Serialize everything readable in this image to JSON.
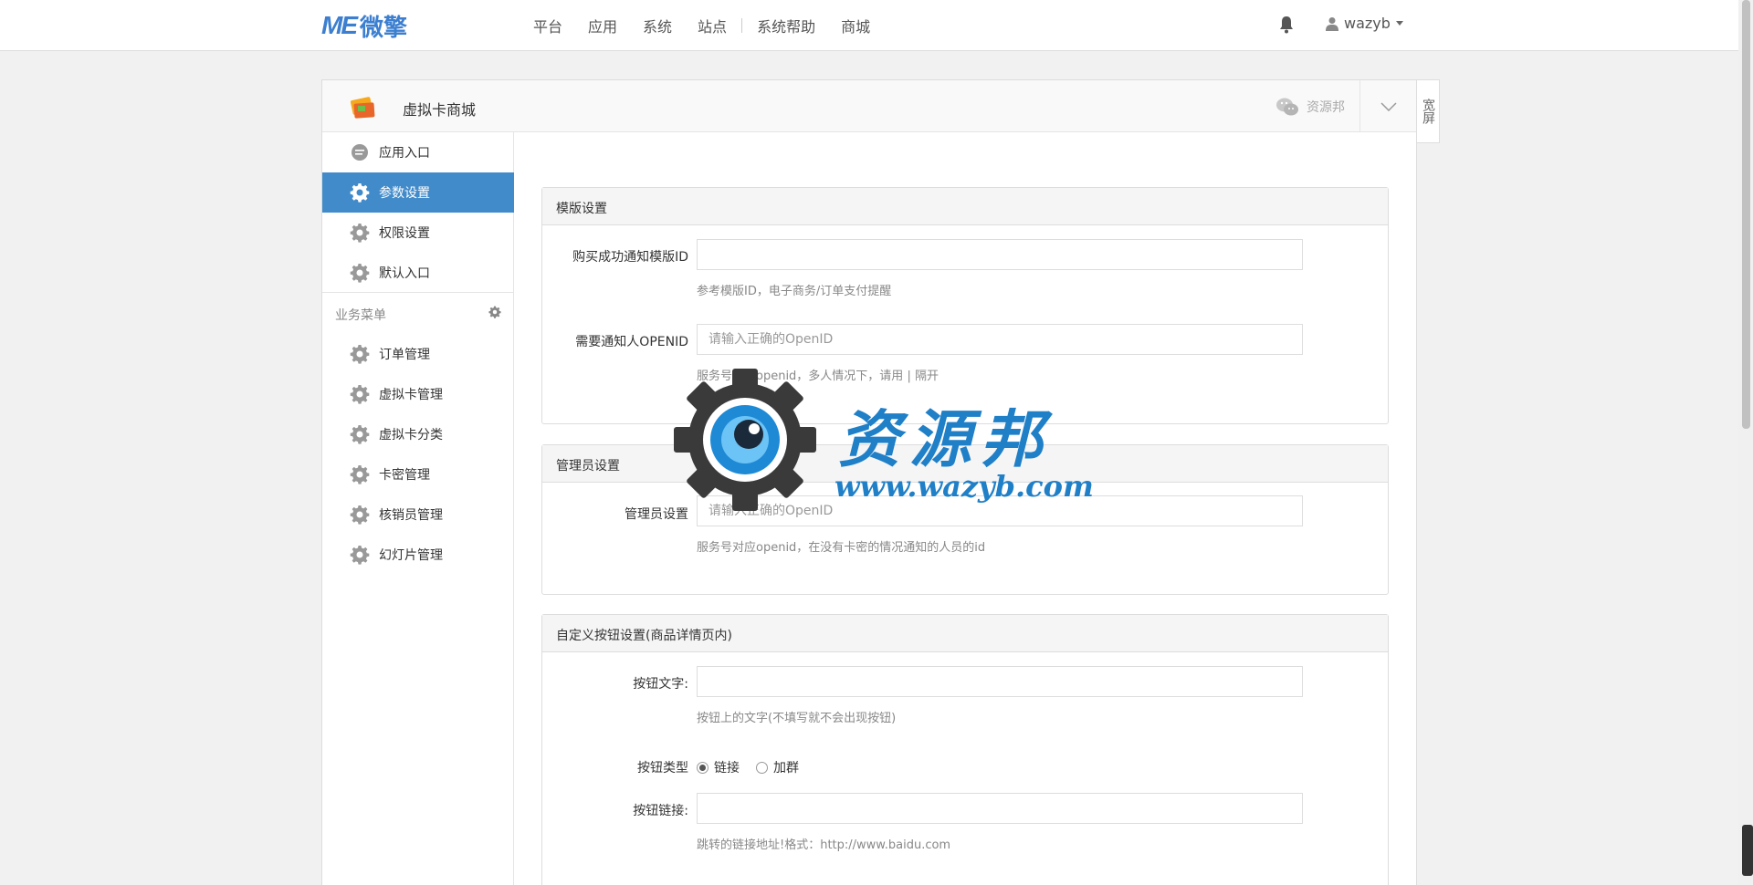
{
  "topbar": {
    "logo_me": "ME",
    "logo_cn": "微擎",
    "nav": [
      "平台",
      "应用",
      "系统",
      "站点",
      "系统帮助",
      "商城"
    ],
    "username": "wazyb"
  },
  "panel": {
    "app_title": "虚拟卡商城",
    "wechat_account": "资源邦",
    "wide_label": "宽屏"
  },
  "sidebar": {
    "items": [
      {
        "label": "应用入口",
        "icon": "chat-icon"
      },
      {
        "label": "参数设置",
        "icon": "gear-icon",
        "active": true
      },
      {
        "label": "权限设置",
        "icon": "gear-icon"
      },
      {
        "label": "默认入口",
        "icon": "gear-icon"
      }
    ],
    "group_title": "业务菜单",
    "business_items": [
      {
        "label": "订单管理",
        "icon": "gear-icon"
      },
      {
        "label": "虚拟卡管理",
        "icon": "gear-icon"
      },
      {
        "label": "虚拟卡分类",
        "icon": "gear-icon"
      },
      {
        "label": "卡密管理",
        "icon": "gear-icon"
      },
      {
        "label": "核销员管理",
        "icon": "gear-icon"
      },
      {
        "label": "幻灯片管理",
        "icon": "gear-icon"
      }
    ]
  },
  "sections": {
    "template": {
      "title": "模版设置",
      "f1_label": "购买成功通知模版ID",
      "f1_value": "",
      "f1_help": "参考模版ID，电子商务/订单支付提醒",
      "f2_label": "需要通知人OPENID",
      "f2_placeholder": "请输入正确的OpenID",
      "f2_help": "服务号对应openid，多人情况下，请用 | 隔开"
    },
    "admin": {
      "title": "管理员设置",
      "f1_label": "管理员设置",
      "f1_placeholder": "请输入正确的OpenID",
      "f1_help": "服务号对应openid，在没有卡密的情况通知的人员的id"
    },
    "custom_button": {
      "title": "自定义按钮设置(商品详情页内)",
      "text_label": "按钮文字:",
      "text_value": "",
      "text_help": "按钮上的文字(不填写就不会出现按钮)",
      "type_label": "按钮类型",
      "type_options": [
        "链接",
        "加群"
      ],
      "type_selected": "链接",
      "link_label": "按钮链接:",
      "link_value": "",
      "link_help": "跳转的链接地址!格式：http://www.baidu.com"
    }
  },
  "watermark": {
    "cn": "资源邦",
    "url": "www.wazyb.com"
  },
  "colors": {
    "accent": "#428bca",
    "logo": "#3c7fd0"
  }
}
